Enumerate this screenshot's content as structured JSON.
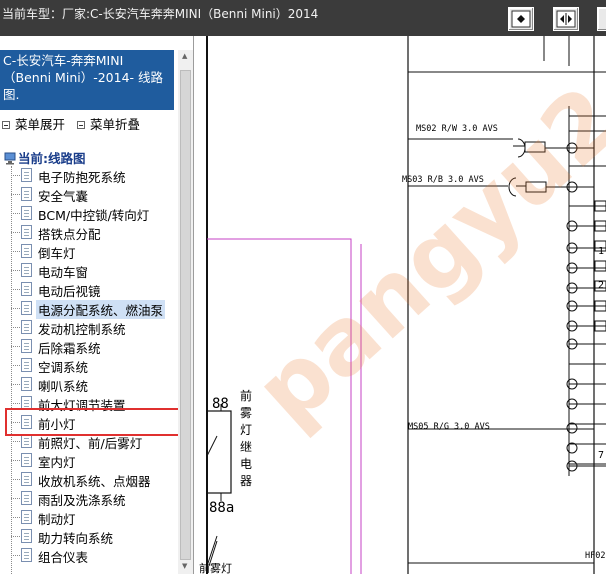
{
  "window": {
    "title": "当前车型：厂家:C-长安汽车奔奔MINI（Benni Mini）2014"
  },
  "toolbar": {
    "icons": [
      "fit-page-icon",
      "fit-width-icon",
      "next-icon"
    ]
  },
  "sidebar": {
    "header": "C-长安汽车-奔奔MINI（Benni Mini）-2014- 线路图.",
    "expand_label": "菜单展开",
    "collapse_label": "菜单折叠",
    "root_label": "当前:线路图",
    "items": [
      {
        "label": "电子防抱死系统"
      },
      {
        "label": "安全气囊"
      },
      {
        "label": "BCM/中控锁/转向灯"
      },
      {
        "label": "搭铁点分配"
      },
      {
        "label": "倒车灯"
      },
      {
        "label": "电动车窗"
      },
      {
        "label": "电动后视镜"
      },
      {
        "label": "电源分配系统、燃油泵"
      },
      {
        "label": "发动机控制系统"
      },
      {
        "label": "后除霜系统"
      },
      {
        "label": "空调系统"
      },
      {
        "label": "喇叭系统"
      },
      {
        "label": "前大灯调节装置"
      },
      {
        "label": "前小灯"
      },
      {
        "label": "前照灯、前/后雾灯"
      },
      {
        "label": "室内灯"
      },
      {
        "label": "收放机系统、点烟器"
      },
      {
        "label": "雨刮及洗涤系统"
      },
      {
        "label": "制动灯"
      },
      {
        "label": "助力转向系统"
      },
      {
        "label": "组合仪表"
      }
    ],
    "selected_index": 7
  },
  "diagram": {
    "wires": [
      {
        "label": "MS02  R/W  3.0  AVS"
      },
      {
        "label": "MS03  R/B  3.0  AVS"
      },
      {
        "label": "MS05  R/G  3.0  AVS"
      }
    ],
    "relay_text": "前雾灯继电器",
    "pin_88": "88",
    "pin_88a": "88a",
    "bottom_left_text": "前雾灯",
    "bottom_right_text": "HF02",
    "right_numbers": [
      "1",
      "2",
      "7"
    ],
    "watermark": "pangyu2"
  }
}
